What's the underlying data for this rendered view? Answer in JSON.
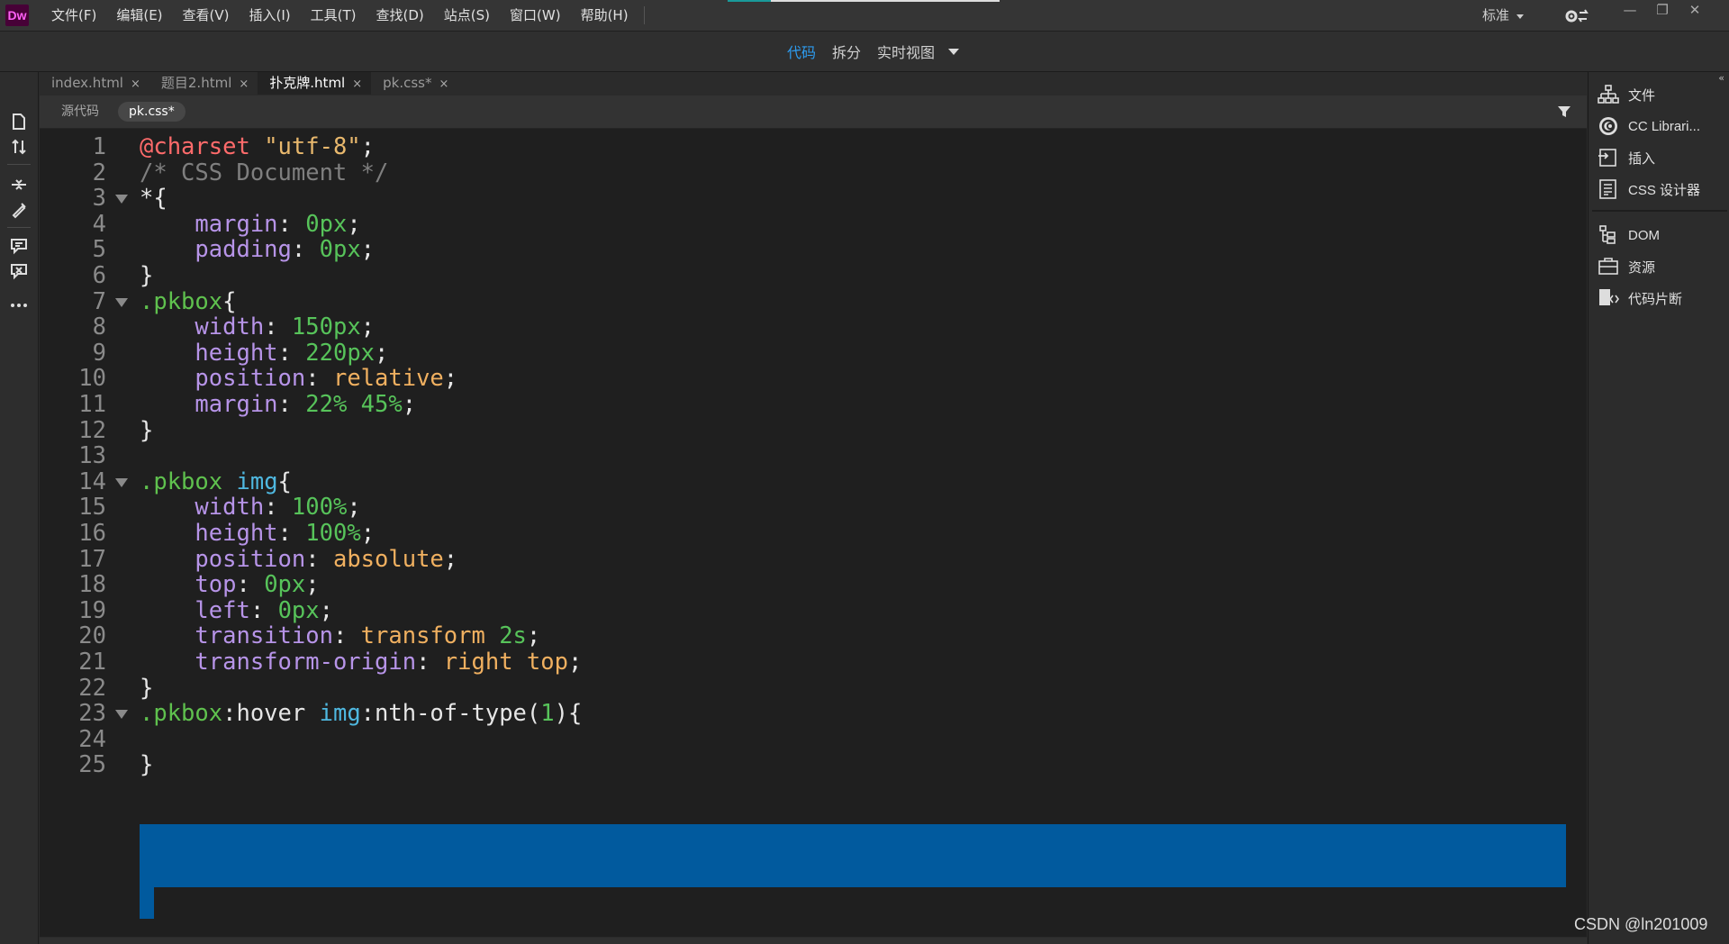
{
  "app": {
    "logo": "Dw"
  },
  "menu": {
    "items": [
      "文件(F)",
      "编辑(E)",
      "查看(V)",
      "插入(I)",
      "工具(T)",
      "查找(D)",
      "站点(S)",
      "窗口(W)",
      "帮助(H)"
    ],
    "workspace": "标准",
    "progress": 0.16
  },
  "view_modes": {
    "code": "代码",
    "split": "拆分",
    "live": "实时视图"
  },
  "doc_tabs": [
    {
      "label": "index.html",
      "close": "×"
    },
    {
      "label": "题目2.html",
      "close": "×"
    },
    {
      "label": "扑克牌.html",
      "close": "×"
    },
    {
      "label": "pk.css*",
      "close": "×"
    }
  ],
  "related_files": {
    "source": "源代码",
    "css": "pk.css*"
  },
  "code_lines": [
    {
      "num": "1",
      "tokens": [
        [
          "at",
          "@charset"
        ],
        [
          "punc",
          " "
        ],
        [
          "str",
          "\"utf-8\""
        ],
        [
          "punc",
          ";"
        ]
      ]
    },
    {
      "num": "2",
      "tokens": [
        [
          "com",
          "/* CSS Document */"
        ]
      ]
    },
    {
      "num": "3",
      "tokens": [
        [
          "punc",
          "*{"
        ]
      ]
    },
    {
      "num": "4",
      "tokens": [
        [
          "punc",
          "    "
        ],
        [
          "prop",
          "margin"
        ],
        [
          "punc",
          ": "
        ],
        [
          "num",
          "0px"
        ],
        [
          "punc",
          ";"
        ]
      ]
    },
    {
      "num": "5",
      "tokens": [
        [
          "punc",
          "    "
        ],
        [
          "prop",
          "padding"
        ],
        [
          "punc",
          ": "
        ],
        [
          "num",
          "0px"
        ],
        [
          "punc",
          ";"
        ]
      ]
    },
    {
      "num": "6",
      "tokens": [
        [
          "punc",
          "}"
        ]
      ]
    },
    {
      "num": "7",
      "tokens": [
        [
          "cls",
          ".pkbox"
        ],
        [
          "punc",
          "{"
        ]
      ]
    },
    {
      "num": "8",
      "tokens": [
        [
          "punc",
          "    "
        ],
        [
          "prop",
          "width"
        ],
        [
          "punc",
          ": "
        ],
        [
          "num",
          "150px"
        ],
        [
          "punc",
          ";"
        ]
      ]
    },
    {
      "num": "9",
      "tokens": [
        [
          "punc",
          "    "
        ],
        [
          "prop",
          "height"
        ],
        [
          "punc",
          ": "
        ],
        [
          "num",
          "220px"
        ],
        [
          "punc",
          ";"
        ]
      ]
    },
    {
      "num": "10",
      "tokens": [
        [
          "punc",
          "    "
        ],
        [
          "prop",
          "position"
        ],
        [
          "punc",
          ": "
        ],
        [
          "val",
          "relative"
        ],
        [
          "punc",
          ";"
        ]
      ]
    },
    {
      "num": "11",
      "tokens": [
        [
          "punc",
          "    "
        ],
        [
          "prop",
          "margin"
        ],
        [
          "punc",
          ": "
        ],
        [
          "num",
          "22% 45%"
        ],
        [
          "punc",
          ";"
        ]
      ]
    },
    {
      "num": "12",
      "tokens": [
        [
          "punc",
          "}"
        ]
      ]
    },
    {
      "num": "13",
      "tokens": []
    },
    {
      "num": "14",
      "tokens": [
        [
          "cls",
          ".pkbox"
        ],
        [
          "punc",
          " "
        ],
        [
          "tag",
          "img"
        ],
        [
          "punc",
          "{"
        ]
      ]
    },
    {
      "num": "15",
      "tokens": [
        [
          "punc",
          "    "
        ],
        [
          "prop",
          "width"
        ],
        [
          "punc",
          ": "
        ],
        [
          "num",
          "100%"
        ],
        [
          "punc",
          ";"
        ]
      ]
    },
    {
      "num": "16",
      "tokens": [
        [
          "punc",
          "    "
        ],
        [
          "prop",
          "height"
        ],
        [
          "punc",
          ": "
        ],
        [
          "num",
          "100%"
        ],
        [
          "punc",
          ";"
        ]
      ]
    },
    {
      "num": "17",
      "tokens": [
        [
          "punc",
          "    "
        ],
        [
          "prop",
          "position"
        ],
        [
          "punc",
          ": "
        ],
        [
          "val",
          "absolute"
        ],
        [
          "punc",
          ";"
        ]
      ]
    },
    {
      "num": "18",
      "tokens": [
        [
          "punc",
          "    "
        ],
        [
          "prop",
          "top"
        ],
        [
          "punc",
          ": "
        ],
        [
          "num",
          "0px"
        ],
        [
          "punc",
          ";"
        ]
      ]
    },
    {
      "num": "19",
      "tokens": [
        [
          "punc",
          "    "
        ],
        [
          "prop",
          "left"
        ],
        [
          "punc",
          ": "
        ],
        [
          "num",
          "0px"
        ],
        [
          "punc",
          ";"
        ]
      ]
    },
    {
      "num": "20",
      "tokens": [
        [
          "punc",
          "    "
        ],
        [
          "prop",
          "transition"
        ],
        [
          "punc",
          ": "
        ],
        [
          "val",
          "transform"
        ],
        [
          "punc",
          " "
        ],
        [
          "num",
          "2s"
        ],
        [
          "punc",
          ";"
        ]
      ]
    },
    {
      "num": "21",
      "tokens": [
        [
          "punc",
          "    "
        ],
        [
          "prop",
          "transform-origin"
        ],
        [
          "punc",
          ": "
        ],
        [
          "val",
          "right top"
        ],
        [
          "punc",
          ";"
        ]
      ]
    },
    {
      "num": "22",
      "tokens": [
        [
          "punc",
          "}"
        ]
      ]
    },
    {
      "num": "23",
      "tokens": [
        [
          "cls",
          ".pkbox"
        ],
        [
          "pseudo",
          ":hover"
        ],
        [
          "punc",
          " "
        ],
        [
          "tag",
          "img"
        ],
        [
          "pseudo",
          ":nth-of-type("
        ],
        [
          "num",
          "1"
        ],
        [
          "pseudo",
          ")"
        ],
        [
          "punc",
          "{"
        ]
      ]
    },
    {
      "num": "24",
      "tokens": []
    },
    {
      "num": "25",
      "tokens": [
        [
          "punc",
          "}"
        ]
      ]
    }
  ],
  "folded_lines": [
    "3",
    "7",
    "14",
    "23"
  ],
  "selected_lines": [
    "23",
    "24",
    "25"
  ],
  "panels": [
    {
      "label": "文件",
      "icon": "files-icon"
    },
    {
      "label": "CC Librari...",
      "icon": "cc-libraries-icon"
    },
    {
      "label": "插入",
      "icon": "insert-icon"
    },
    {
      "label": "CSS 设计器",
      "icon": "css-designer-icon"
    },
    {
      "label": "DOM",
      "icon": "dom-icon"
    },
    {
      "label": "资源",
      "icon": "assets-icon"
    },
    {
      "label": "代码片断",
      "icon": "snippets-icon"
    }
  ],
  "watermark": "CSDN @ln201009",
  "colors": {
    "selection": "#015a9e",
    "active_view": "#2d9cf0",
    "at_rule": "#ff6b6b",
    "property": "#b794e8",
    "number": "#57c35a",
    "value": "#f0b060",
    "tag": "#4fb8e0"
  }
}
